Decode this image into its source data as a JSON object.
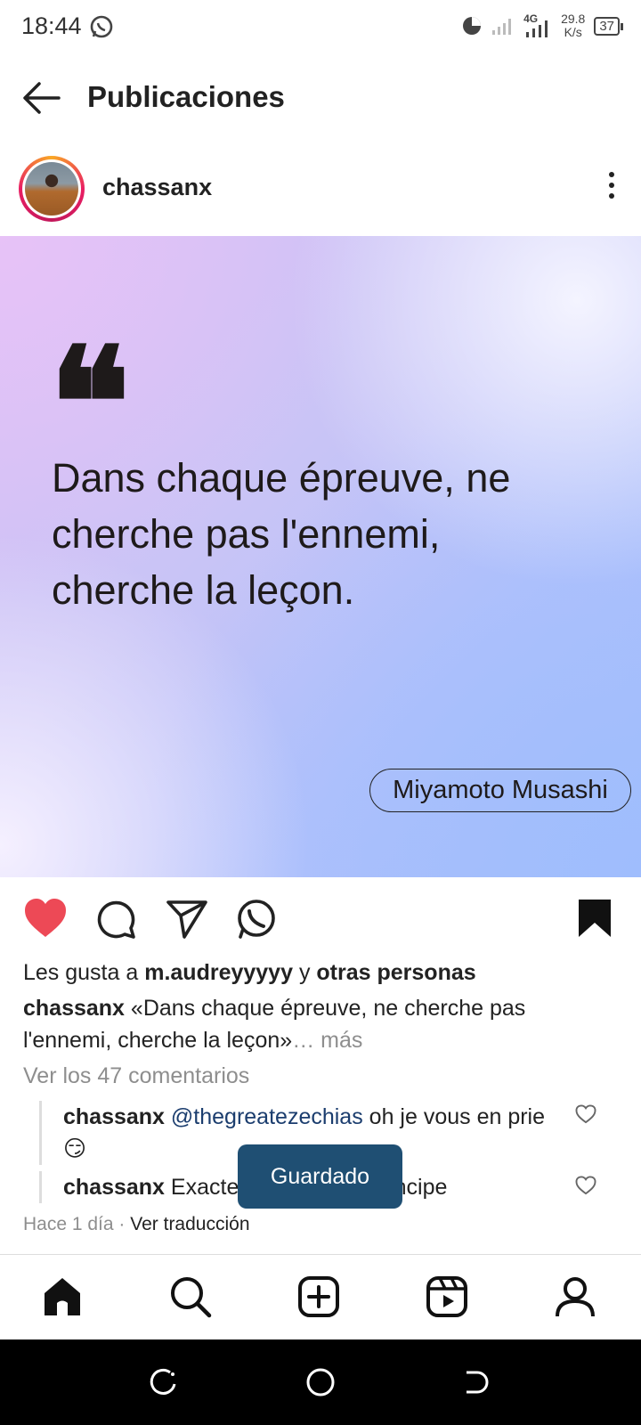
{
  "status_bar": {
    "time": "18:44",
    "network": "4G",
    "speed_value": "29.8",
    "speed_unit": "K/s",
    "battery": "37"
  },
  "header": {
    "title": "Publicaciones"
  },
  "post": {
    "username": "chassanx",
    "quote_mark": "❝",
    "quote_lines": [
      "Dans chaque épreuve, ne",
      "cherche pas l'ennemi,",
      "cherche la leçon."
    ],
    "author": "Miyamoto Musashi",
    "likes_prefix": "Les gusta a ",
    "likes_user": "m.audreyyyyy",
    "likes_middle": " y ",
    "likes_others": "otras personas",
    "caption_user": "chassanx",
    "caption_text": " «Dans chaque épreuve, ne cherche pas l'ennemi, cherche la leçon»",
    "caption_more": "… más",
    "view_comments": "Ver los 47 comentarios",
    "comments": [
      {
        "user": "chassanx",
        "mention": "@thegreatezechias",
        "text": " oh je vous en prie",
        "emoji": "😏"
      },
      {
        "user": "chassanx",
        "text": " Exactement c'est le principe"
      }
    ],
    "time_ago": "Hace 1 día",
    "separator": " · ",
    "translate": "Ver traducción"
  },
  "toast": "Guardado",
  "colors": {
    "like_red": "#ed4956",
    "toast_bg": "#1f4f73",
    "mention": "#1b3d6e"
  },
  "icons": [
    "back-arrow-icon",
    "heart-icon",
    "comment-icon",
    "send-icon",
    "whatsapp-icon",
    "bookmark-icon",
    "home-icon",
    "search-icon",
    "add-icon",
    "reels-icon",
    "profile-icon"
  ]
}
